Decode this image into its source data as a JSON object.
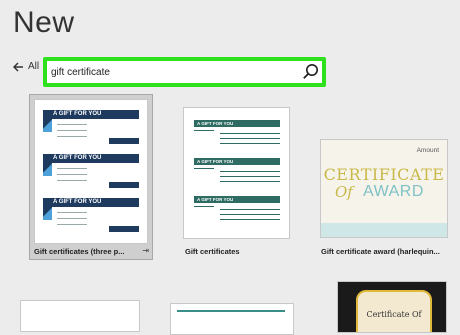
{
  "page": {
    "title": "New"
  },
  "nav": {
    "back_label": "All"
  },
  "search": {
    "value": "gift certificate"
  },
  "templates": [
    {
      "caption": "Gift certificates (three p...",
      "heading": "A GIFT FOR YOU",
      "field_labels": [
        "Recipient",
        "Amount",
        "From"
      ]
    },
    {
      "caption": "Gift certificates",
      "heading": "A GIFT FOR YOU",
      "logo_text": "LOGO"
    },
    {
      "caption": "Gift certificate award (harlequin...",
      "title": "CERTIFICATE",
      "of": "Of",
      "award": "AWARD",
      "amount_label": "Amount"
    },
    {
      "caption": ""
    },
    {
      "caption": ""
    },
    {
      "caption": "",
      "title": "Certificate Of"
    }
  ],
  "colors": {
    "search_highlight": "#2fe01d",
    "certificate_navy": "#1e3a5f",
    "gift_teal": "#2e6b62",
    "award_gold": "#c9b84a",
    "award_teal": "#7fc1c6"
  }
}
